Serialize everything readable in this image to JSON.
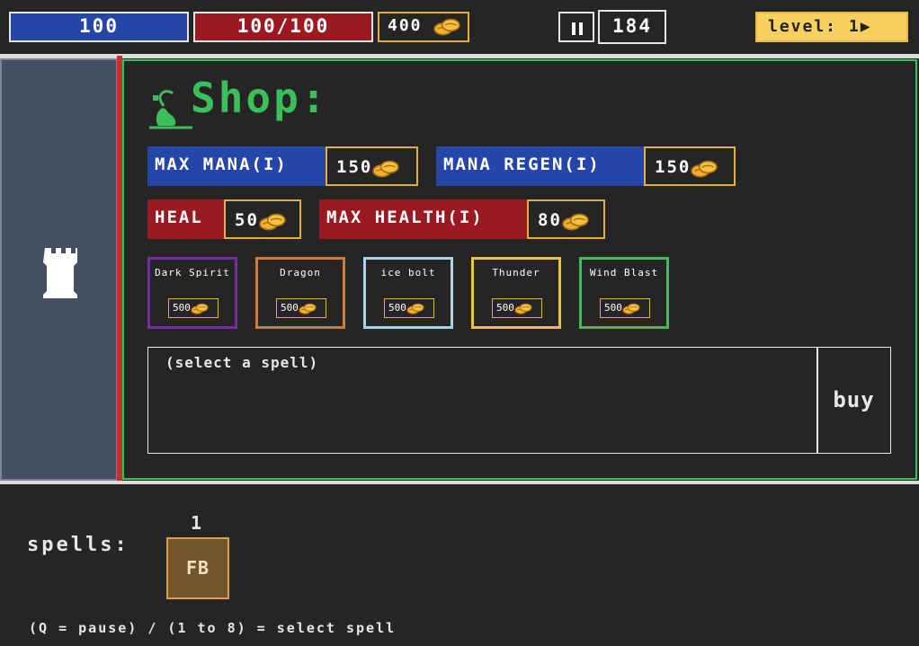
{
  "hud": {
    "mana": "100",
    "health": "100/100",
    "gold": "400",
    "timer": "184",
    "level": "level: 1▶"
  },
  "shop": {
    "title": "Shop:",
    "upgrades": [
      {
        "label": "MAX MANA(I)",
        "price": "150",
        "color": "#2545a8"
      },
      {
        "label": "MANA REGEN(I)",
        "price": "150",
        "color": "#2545a8"
      },
      {
        "label": "HEAL",
        "price": "50",
        "color": "#9b1a22"
      },
      {
        "label": "MAX HEALTH(I)",
        "price": "80",
        "color": "#9b1a22"
      }
    ],
    "spells": [
      {
        "name": "Dark Spirit",
        "price": "500",
        "border": "#7a2aa8"
      },
      {
        "name": "Dragon",
        "price": "500",
        "border": "#d8782c"
      },
      {
        "name": "ice bolt",
        "price": "500",
        "border": "#a8d4e8"
      },
      {
        "name": "Thunder",
        "price": "500",
        "border": "#f0c040"
      },
      {
        "name": "Wind Blast",
        "price": "500",
        "border": "#3bbf5a"
      }
    ],
    "description": "(select a spell)",
    "buy_label": "buy"
  },
  "bottom": {
    "spells_label": "spells:",
    "slot_number": "1",
    "slot_spell": "FB",
    "help": "(Q = pause) / (1 to 8) = select spell"
  },
  "colors": {
    "accent_green": "#3bbf5a",
    "gold": "#e0b040",
    "level_bg": "#f6d060"
  },
  "icons": [
    "coin-stack-icon",
    "pause-icon",
    "tower-icon",
    "shop-icon",
    "play-arrow-icon"
  ]
}
